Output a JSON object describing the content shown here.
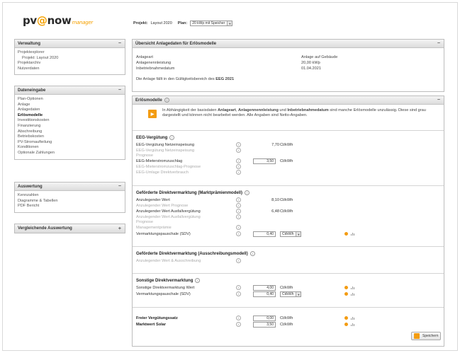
{
  "logo": {
    "brand_a": "pv",
    "brand_at": "@",
    "brand_b": "now",
    "brand_sub": "manager"
  },
  "header": {
    "project_label": "Projekt:",
    "project_value": "Layout 2020",
    "plan_label": "Plan:",
    "plan_value": "20 kWp mit Speicher"
  },
  "sidebar": {
    "verwaltung": {
      "title": "Verwaltung",
      "toggle": "−",
      "items": [
        "Projektexplorer",
        "Projekt: Layout 2020",
        "Projektarchiv",
        "Nutzerdaten"
      ]
    },
    "dateneingabe": {
      "title": "Dateneingabe",
      "toggle": "−",
      "items": [
        "Plan-Optionen",
        "Anlage",
        "Anlagedaten",
        "Erlösmodelle",
        "Investitionskosten",
        "Finanzierung",
        "Abschreibung",
        "Betriebskosten",
        "PV-Stromaufteilung",
        "Konditionen",
        "Optionale Zahlungen"
      ]
    },
    "auswertung": {
      "title": "Auswertung",
      "toggle": "−",
      "items": [
        "Kennzahlen",
        "Diagramme & Tabellen",
        "PDF Bericht"
      ]
    },
    "vergleichende": {
      "title": "Vergleichende Auswertung",
      "toggle": "+"
    }
  },
  "overview": {
    "title": "Übersicht Anlagedaten für Erlösmodelle",
    "toggle": "−",
    "rows": [
      {
        "label": "Anlageart",
        "value": "Anlage auf Gebäude"
      },
      {
        "label": "Anlagenennleistung",
        "value": "20,00 kWp"
      },
      {
        "label": "Inbetriebnahmedatum",
        "value": "01.04.2021"
      }
    ],
    "eeg_note_prefix": "Die Anlage fällt in den Gültigkeitsbereich des",
    "eeg_note_bold": "EEG 2021"
  },
  "erloes": {
    "title": "Erlösmodelle",
    "toggle": "−",
    "notice_a": "In Abhängigkeit der basisdaten ",
    "notice_b": "Anlageart",
    "notice_c": ", ",
    "notice_d": "Anlagennennleistung",
    "notice_e": " und ",
    "notice_f": "Inbetriebnahmedatum",
    "notice_g": " sind manche Erlösmodelle unzulässig. Diese sind grau dargestellt und können nicht bearbeitet werden. Alle Angaben sind Netto-Angaben.",
    "eeg": {
      "title": "EEG-Vergütung",
      "rows": [
        {
          "label": "EEG-Vergütung Netzeinspeisung",
          "value": "7,70",
          "unit": "Ct/kWh"
        },
        {
          "label": "EEG-Vergütung Netzeinspeisung",
          "disabled": true
        },
        {
          "label": "Prognose",
          "disabled": true
        },
        {
          "label": "EEG-Mieterstromzuschlag",
          "input": "3,50",
          "unit": "Ct/kWh"
        },
        {
          "label": "EEG-Mieterstromzuschlag-Prognose",
          "disabled": true
        },
        {
          "label": "EEG-Umlage Direktverbrauch",
          "disabled": true
        }
      ]
    },
    "marktpraemie": {
      "title": "Geförderte Direktvermarktung (Marktprämienmodell)",
      "rows": [
        {
          "label": "Anzulegender Wert",
          "value": "8,10",
          "unit": "Ct/kWh"
        },
        {
          "label": "Anzulegender Wert Prognose",
          "disabled": true
        },
        {
          "label": "Anzulegender Wert Ausfallvergütung",
          "value": "6,48",
          "unit": "Ct/kWh"
        },
        {
          "label": "Anzulegender Wert Ausfallvergütung",
          "disabled": true
        },
        {
          "label": "Prognose",
          "disabled": true
        },
        {
          "label": "Managementprämie",
          "disabled": true
        },
        {
          "label": "Vermarktungspauschale (SDV)",
          "input": "0,40",
          "unitsel": "Ct/kWh"
        }
      ]
    },
    "ausschreibung": {
      "title": "Geförderte Direktvermarktung (Ausschreibungsmodell)",
      "rows": [
        {
          "label": "Anzulegender Wert & Ausschreibung",
          "disabled": true
        }
      ]
    },
    "sonstige": {
      "title": "Sonstige Direktvermarktung",
      "rows": [
        {
          "label": "Sonstige Direktvermarktung Wert",
          "input": "4,00",
          "unit": "Ct/kWh"
        },
        {
          "label": "Vermarktungspauschale (SDV)",
          "input": "0,40",
          "unitsel": "Ct/kWh"
        }
      ]
    },
    "frei": {
      "rows": [
        {
          "label": "Freier Vergütungssatz",
          "input": "0,00",
          "unit": "Ct/kWh"
        },
        {
          "label": "Marktwert Solar",
          "input": "3,50",
          "unit": "Ct/kWh"
        }
      ]
    },
    "save_label": "Speichern"
  },
  "colors": {
    "accent": "#f39c12",
    "header_bar": "#dcdcdc"
  },
  "icons": {
    "info": "info-icon",
    "notice": "notice-icon",
    "save": "save-icon"
  }
}
